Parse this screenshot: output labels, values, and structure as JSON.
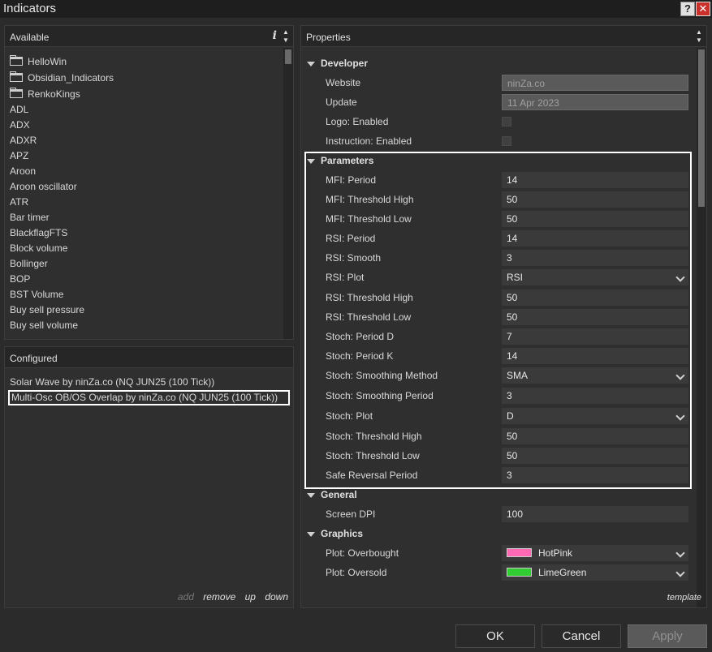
{
  "window": {
    "title": "Indicators",
    "help_label": "?",
    "close_label": "✕"
  },
  "available": {
    "header": "Available",
    "info_label": "i",
    "folders": [
      "HelloWin",
      "Obsidian_Indicators",
      "RenkoKings"
    ],
    "items": [
      "ADL",
      "ADX",
      "ADXR",
      "APZ",
      "Aroon",
      "Aroon oscillator",
      "ATR",
      "Bar timer",
      "BlackflagFTS",
      "Block volume",
      "Bollinger",
      "BOP",
      "BST Volume",
      "Buy sell pressure",
      "Buy sell volume"
    ]
  },
  "configured": {
    "header": "Configured",
    "items": [
      {
        "label": "Solar Wave by ninZa.co (NQ JUN25 (100 Tick))",
        "selected": false
      },
      {
        "label": "Multi-Osc OB/OS Overlap by ninZa.co (NQ JUN25 (100 Tick))",
        "selected": true
      }
    ],
    "actions": {
      "add": "add",
      "remove": "remove",
      "up": "up",
      "down": "down"
    }
  },
  "properties": {
    "header": "Properties",
    "template_label": "template",
    "developer": {
      "title": "Developer",
      "website_label": "Website",
      "website_value": "ninZa.co",
      "update_label": "Update",
      "update_value": "11 Apr 2023",
      "logo_label": "Logo: Enabled",
      "instruction_label": "Instruction: Enabled"
    },
    "parameters": {
      "title": "Parameters",
      "rows": [
        {
          "label": "MFI: Period",
          "value": "14"
        },
        {
          "label": "MFI: Threshold High",
          "value": "50"
        },
        {
          "label": "MFI: Threshold Low",
          "value": "50"
        },
        {
          "label": "RSI: Period",
          "value": "14"
        },
        {
          "label": "RSI: Smooth",
          "value": "3"
        },
        {
          "label": "RSI: Plot",
          "value": "RSI"
        },
        {
          "label": "RSI: Threshold High",
          "value": "50"
        },
        {
          "label": "RSI: Threshold Low",
          "value": "50"
        },
        {
          "label": "Stoch: Period D",
          "value": "7"
        },
        {
          "label": "Stoch: Period K",
          "value": "14"
        },
        {
          "label": "Stoch: Smoothing Method",
          "value": "SMA"
        },
        {
          "label": "Stoch: Smoothing Period",
          "value": "3"
        },
        {
          "label": "Stoch: Plot",
          "value": "D"
        },
        {
          "label": "Stoch: Threshold High",
          "value": "50"
        },
        {
          "label": "Stoch: Threshold Low",
          "value": "50"
        },
        {
          "label": "Safe Reversal Period",
          "value": "3"
        }
      ]
    },
    "general": {
      "title": "General",
      "dpi_label": "Screen DPI",
      "dpi_value": "100"
    },
    "graphics": {
      "title": "Graphics",
      "overbought_label": "Plot: Overbought",
      "overbought_value": "HotPink",
      "overbought_color": "#ff69b4",
      "oversold_label": "Plot: Oversold",
      "oversold_value": "LimeGreen",
      "oversold_color": "#32cd32"
    }
  },
  "buttons": {
    "ok": "OK",
    "cancel": "Cancel",
    "apply": "Apply"
  }
}
